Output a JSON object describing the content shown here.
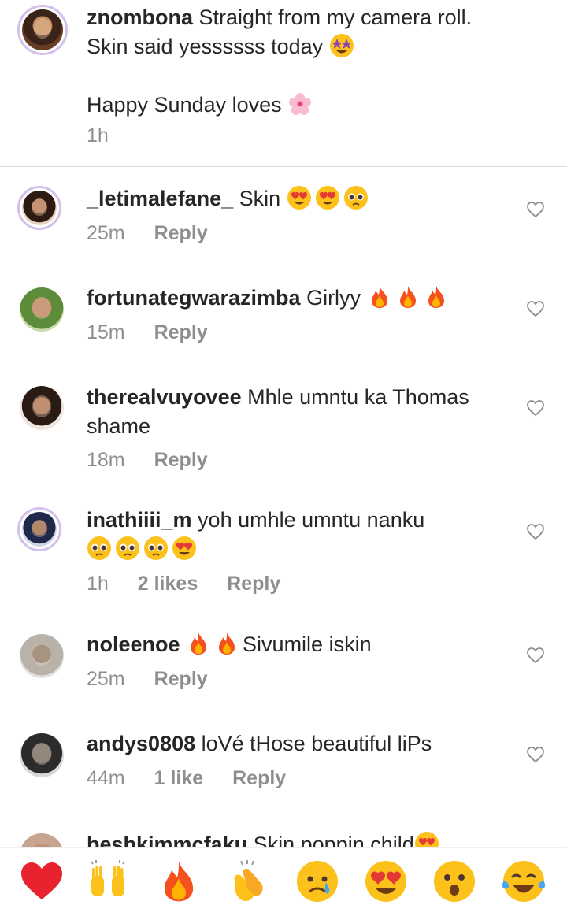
{
  "caption": {
    "username": "znombona",
    "text_line1": "Straight from my camera roll.",
    "text_line2": "Skin said yessssss today",
    "text_line3": "Happy Sunday loves",
    "time": "1h"
  },
  "comments": [
    {
      "username": "_letimalefane_",
      "text": "Skin",
      "time": "25m",
      "likes": "",
      "reply": "Reply"
    },
    {
      "username": "fortunategwarazimba",
      "text": "Girlyy",
      "time": "15m",
      "likes": "",
      "reply": "Reply"
    },
    {
      "username": "therealvuyovee",
      "text": "Mhle umntu ka Thomas shame",
      "time": "18m",
      "likes": "",
      "reply": "Reply"
    },
    {
      "username": "inathiiii_m",
      "text": "yoh umhle umntu nanku",
      "time": "1h",
      "likes": "2 likes",
      "reply": "Reply"
    },
    {
      "username": "noleenoe",
      "text": "Sivumile iskin",
      "time": "25m",
      "likes": "",
      "reply": "Reply"
    },
    {
      "username": "andys0808",
      "text": "loVé  tHose beautiful liPs",
      "time": "44m",
      "likes": "1 like",
      "reply": "Reply"
    },
    {
      "username": "beshkimmcfaku",
      "text": "Skin poppin child",
      "time": "",
      "likes": "",
      "reply": ""
    }
  ],
  "reactions": [
    "red-heart",
    "raising-hands",
    "fire",
    "clapping-hands",
    "sad-face",
    "heart-eyes",
    "surprised-face",
    "tears-of-joy"
  ],
  "colors": {
    "text": "#262626",
    "meta": "#8e8e8e",
    "divider": "#dbdbdb",
    "ring": "#d3c1ea"
  }
}
